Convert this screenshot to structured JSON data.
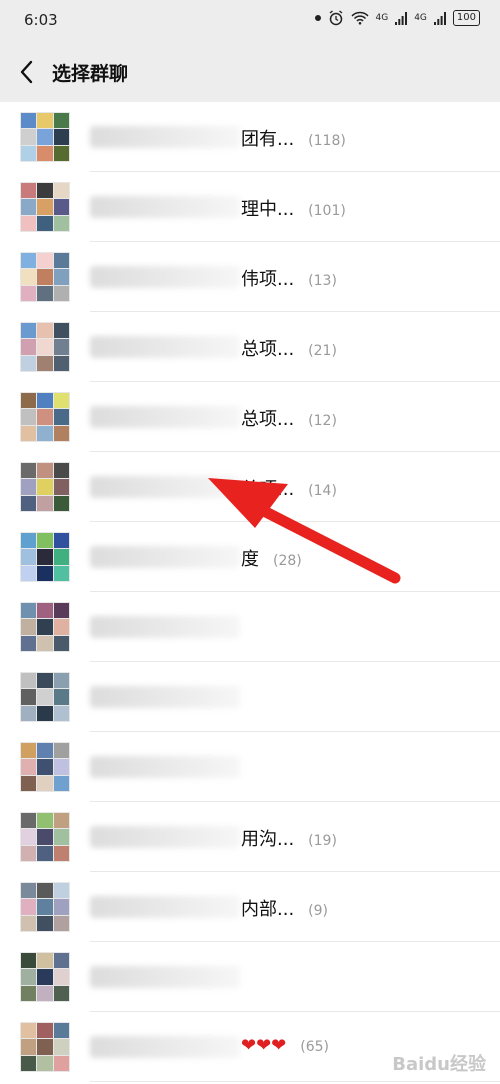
{
  "status_bar": {
    "time": "6:03",
    "network_1": "4G",
    "network_2": "4G",
    "battery": "100"
  },
  "header": {
    "title": "选择群聊",
    "back_icon": "chevron-left-icon"
  },
  "groups": [
    {
      "name": "团有...",
      "count": "(118)",
      "colors": [
        "#5b8cc9",
        "#e8c96a",
        "#4a7a4a",
        "#cfcfcf",
        "#7aa3d9",
        "#2c3e50",
        "#b0d0e8",
        "#d88c6a",
        "#556b2f"
      ]
    },
    {
      "name": "理中...",
      "count": "(101)",
      "colors": [
        "#c97b7b",
        "#3c3c3c",
        "#e6d6c6",
        "#8aa8c8",
        "#d9a066",
        "#5a5a8a",
        "#f0c0c0",
        "#406080",
        "#a0c0a0"
      ]
    },
    {
      "name": "伟项...",
      "count": "(13)",
      "colors": [
        "#7fb0e0",
        "#f5d0d0",
        "#5a7a9a",
        "#f0e0c0",
        "#c08060",
        "#80a0c0",
        "#e0b0c0",
        "#607080",
        "#b0b0b0"
      ]
    },
    {
      "name": "总项...",
      "count": "(21)",
      "colors": [
        "#6a9ad0",
        "#e8c0b0",
        "#405060",
        "#d0a0b0",
        "#f0d8d0",
        "#708090",
        "#c0d0e0",
        "#a08070",
        "#506070"
      ]
    },
    {
      "name": "总项...",
      "count": "(12)",
      "colors": [
        "#8c6a4a",
        "#5080c0",
        "#e0e070",
        "#c0c0c0",
        "#d09080",
        "#4a6a8a",
        "#e0c0a0",
        "#90b0d0",
        "#b08060"
      ]
    },
    {
      "name": "总项...",
      "count": "(14)",
      "colors": [
        "#6a6a6a",
        "#c09080",
        "#4a4a4a",
        "#a0a0c0",
        "#e0d060",
        "#806060",
        "#506080",
        "#c0a0a0",
        "#3a5a3a"
      ]
    },
    {
      "name": "度",
      "count": "(28)",
      "colors": [
        "#60a0d0",
        "#80c060",
        "#3050a0",
        "#a0c0e0",
        "#2a2a3a",
        "#40b080",
        "#c0d0f0",
        "#1a3060",
        "#50c0a0"
      ]
    },
    {
      "name": "",
      "count": "",
      "colors": [
        "#7090b0",
        "#a06080",
        "#5a3a5a",
        "#c0b0a0",
        "#304050",
        "#e0b0a0",
        "#607090",
        "#d0c0b0",
        "#4a5a6a"
      ]
    },
    {
      "name": "",
      "count": "",
      "colors": [
        "#c0c0c0",
        "#3a4a5a",
        "#8aa0b0",
        "#606060",
        "#d0d0d0",
        "#5a7a8a",
        "#a0b0c0",
        "#2a3a4a",
        "#b0c0d0"
      ]
    },
    {
      "name": "",
      "count": "",
      "colors": [
        "#d0a060",
        "#6080b0",
        "#a0a0a0",
        "#e0b0b0",
        "#405070",
        "#c0c0e0",
        "#806050",
        "#e0d0c0",
        "#70a0d0"
      ]
    },
    {
      "name": "用沟...",
      "count": "(19)",
      "colors": [
        "#6a6a6a",
        "#90c070",
        "#c0a080",
        "#e0d0e0",
        "#4a4a6a",
        "#a0c0a0",
        "#d0b0b0",
        "#506080",
        "#c08070"
      ]
    },
    {
      "name": "内部...",
      "count": "(9)",
      "colors": [
        "#7a8a9a",
        "#5a5a5a",
        "#c0d0e0",
        "#e0b0c0",
        "#6080a0",
        "#a0a0c0",
        "#d0c0b0",
        "#405060",
        "#b0a0a0"
      ]
    },
    {
      "name": "",
      "count": "",
      "colors": [
        "#3a4a3a",
        "#d0c0a0",
        "#607090",
        "#a0b0a0",
        "#2a3a5a",
        "#e0d0d0",
        "#708060",
        "#c0b0c0",
        "#506050"
      ]
    },
    {
      "name": "",
      "count": "(65)",
      "colors": [
        "#e0c0a0",
        "#a06060",
        "#5a7a9a",
        "#c0a080",
        "#806050",
        "#d0d0c0",
        "#4a5a4a",
        "#b0c0a0",
        "#e0a0a0"
      ]
    }
  ],
  "watermark": "Baidu经验"
}
